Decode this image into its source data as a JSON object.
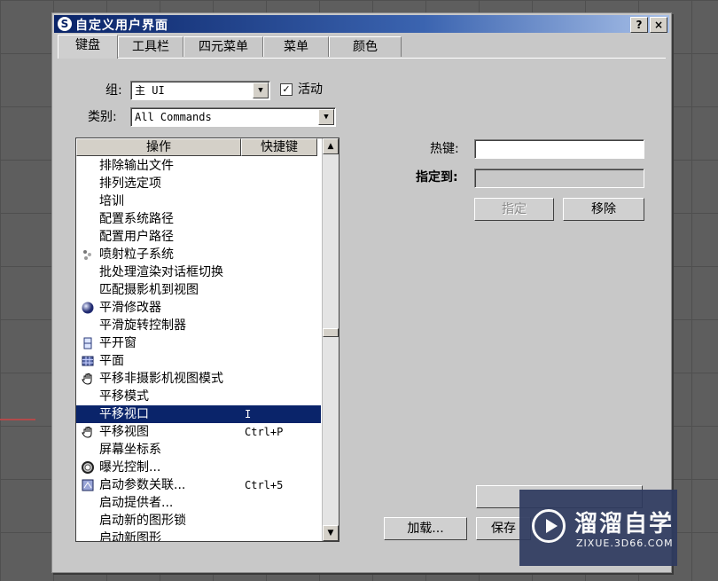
{
  "window": {
    "title": "自定义用户界面",
    "help_label": "?",
    "close_label": "×"
  },
  "tabs": [
    "键盘",
    "工具栏",
    "四元菜单",
    "菜单",
    "颜色"
  ],
  "group": {
    "label": "组:",
    "value": "主 UI",
    "active_label": "活动",
    "active_checked": true
  },
  "category": {
    "label": "类别:",
    "value": "All Commands"
  },
  "list": {
    "col_action": "操作",
    "col_shortcut": "快捷键",
    "rows": [
      {
        "name": "排除输出文件",
        "key": "",
        "icon": ""
      },
      {
        "name": "排列选定项",
        "key": "",
        "icon": ""
      },
      {
        "name": "培训",
        "key": "",
        "icon": ""
      },
      {
        "name": "配置系统路径",
        "key": "",
        "icon": ""
      },
      {
        "name": "配置用户路径",
        "key": "",
        "icon": ""
      },
      {
        "name": "喷射粒子系统",
        "key": "",
        "icon": "particle-icon"
      },
      {
        "name": "批处理渲染对话框切换",
        "key": "",
        "icon": ""
      },
      {
        "name": "匹配摄影机到视图",
        "key": "",
        "icon": ""
      },
      {
        "name": "平滑修改器",
        "key": "",
        "icon": "sphere-icon"
      },
      {
        "name": "平滑旋转控制器",
        "key": "",
        "icon": ""
      },
      {
        "name": "平开窗",
        "key": "",
        "icon": "window-icon"
      },
      {
        "name": "平面",
        "key": "",
        "icon": "plane-grid-icon"
      },
      {
        "name": "平移非摄影机视图模式",
        "key": "",
        "icon": "hand-icon"
      },
      {
        "name": "平移模式",
        "key": "",
        "icon": ""
      },
      {
        "name": "平移视口",
        "key": "I",
        "icon": "",
        "selected": true
      },
      {
        "name": "平移视图",
        "key": "Ctrl+P",
        "icon": "hand-icon"
      },
      {
        "name": "屏幕坐标系",
        "key": "",
        "icon": ""
      },
      {
        "name": "曝光控制...",
        "key": "",
        "icon": "ring-icon"
      },
      {
        "name": "启动参数关联...",
        "key": "Ctrl+5",
        "icon": "param-icon"
      },
      {
        "name": "启动提供者...",
        "key": "",
        "icon": ""
      },
      {
        "name": "启动新的图形锁",
        "key": "",
        "icon": ""
      },
      {
        "name": "启动新图形",
        "key": "",
        "icon": ""
      }
    ]
  },
  "hotkey": {
    "label": "热键:",
    "assigned_label": "指定到:",
    "assign_button": "指定",
    "remove_button": "移除"
  },
  "footer": {
    "load_button": "加载...",
    "save_button": "保存"
  },
  "watermark": {
    "brand": "溜溜自学",
    "url": "ZIXUE.3D66.COM"
  }
}
